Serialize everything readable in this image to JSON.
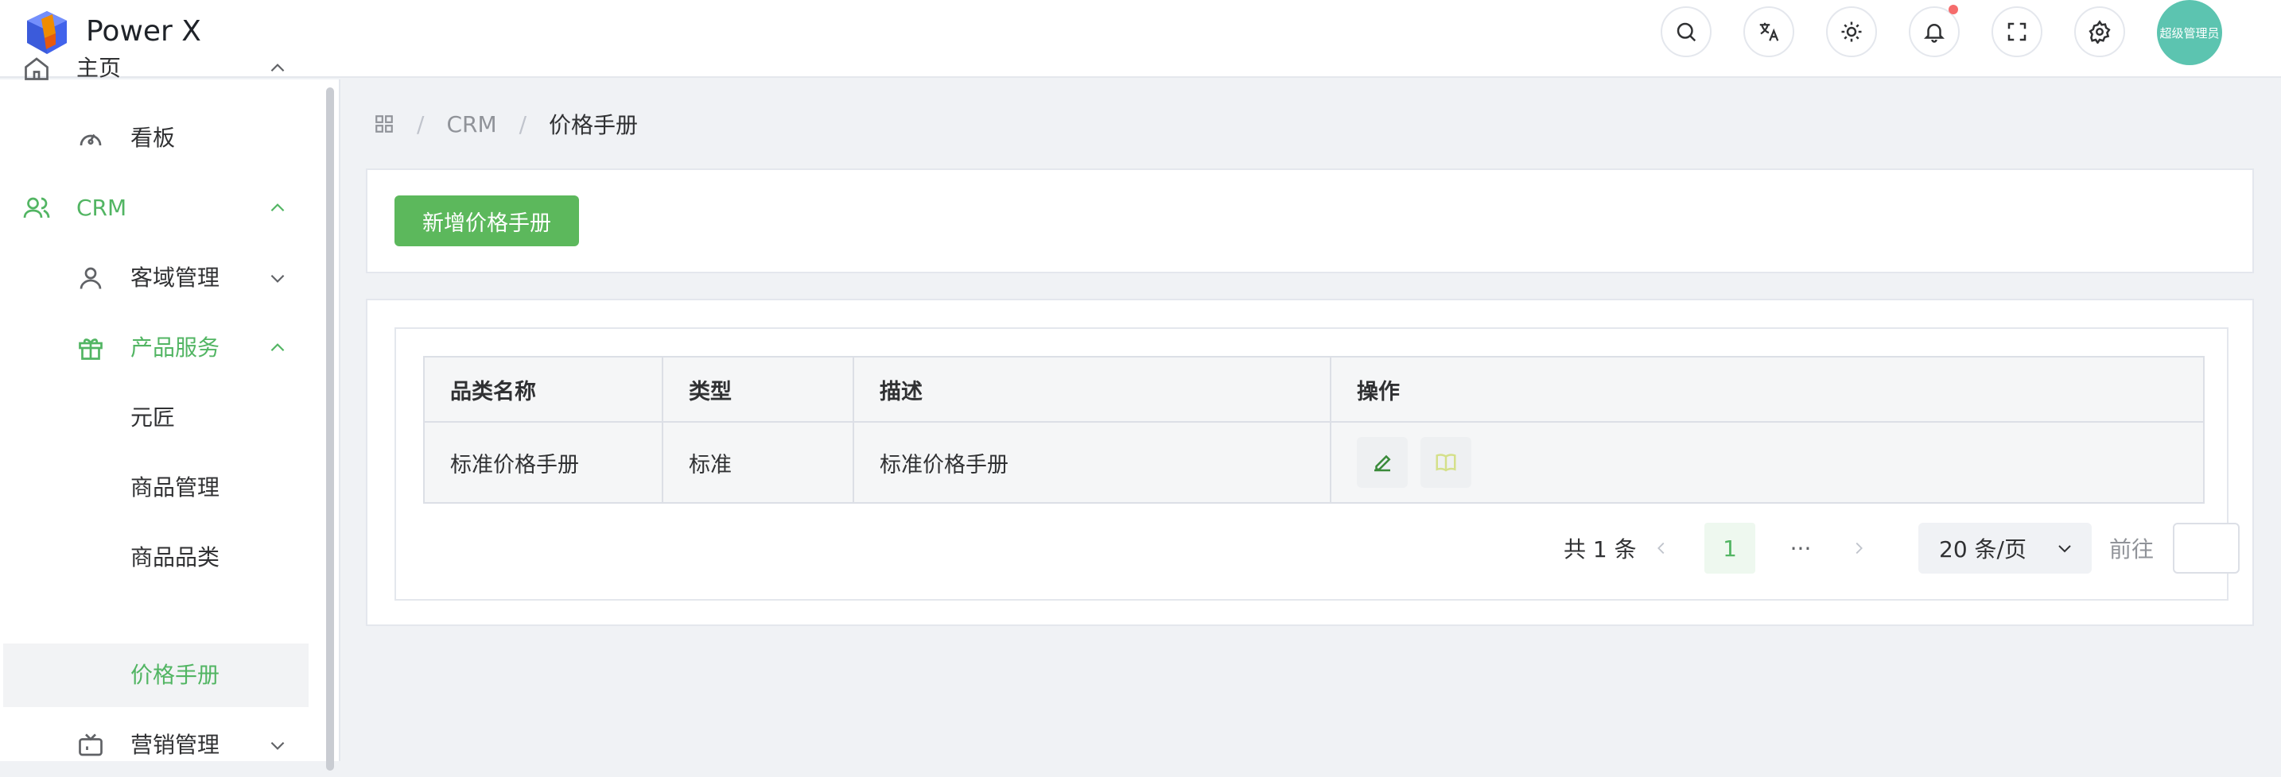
{
  "app": {
    "title": "Power X"
  },
  "header": {
    "buttons": [
      "search-icon",
      "translate-icon",
      "theme-icon",
      "bell-icon",
      "fullscreen-icon",
      "gear-icon"
    ],
    "avatar_label": "超级管理员",
    "notification_dot_color": "#f56c6c"
  },
  "sidebar": {
    "items": [
      {
        "label": "主页",
        "icon": "home-icon",
        "expanded": true
      },
      {
        "label": "看板",
        "icon": "dashboard-icon"
      },
      {
        "label": "CRM",
        "icon": "users-icon",
        "expanded": true,
        "active": true
      },
      {
        "label": "客域管理",
        "icon": "user-icon",
        "expanded": false
      },
      {
        "label": "产品服务",
        "icon": "gift-icon",
        "expanded": true,
        "active": true
      },
      {
        "label": "元匠"
      },
      {
        "label": "商品管理"
      },
      {
        "label": "商品品类"
      },
      {
        "label": "价格手册",
        "selected": true
      },
      {
        "label": "营销管理",
        "icon": "tv-icon",
        "expanded": false
      }
    ]
  },
  "breadcrumb": {
    "items": [
      "CRM",
      "价格手册"
    ]
  },
  "toolbar": {
    "add_label": "新增价格手册"
  },
  "table": {
    "headers": [
      "品类名称",
      "类型",
      "描述",
      "操作"
    ],
    "rows": [
      {
        "name": "标准价格手册",
        "type": "标准",
        "desc": "标准价格手册"
      }
    ]
  },
  "pagination": {
    "total": "共 1 条",
    "current": "1",
    "more": "···",
    "page_size": "20 条/页",
    "goto": "前往"
  },
  "colors": {
    "accent": "#52b563",
    "button": "#5cb85c",
    "avatar": "#5cc4b0"
  }
}
